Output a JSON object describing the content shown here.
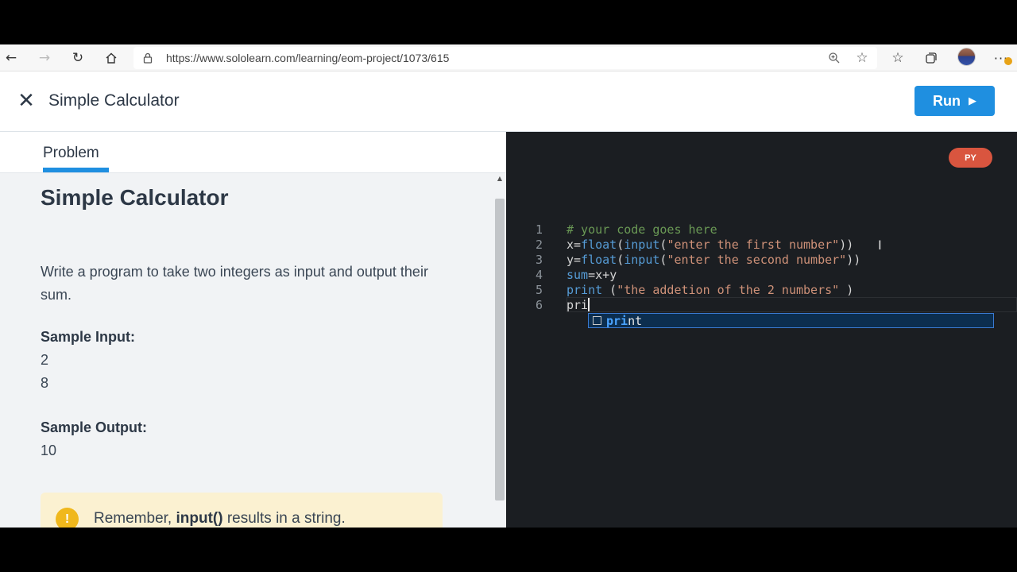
{
  "browser": {
    "url": "https://www.sololearn.com/learning/eom-project/1073/615",
    "icons": {
      "back": "back-arrow-icon",
      "forward": "forward-arrow-icon",
      "refresh": "refresh-icon",
      "home": "home-icon",
      "lock": "lock-icon",
      "zoom": "zoom-icon",
      "add_favorite": "add-favorite-icon",
      "favorites": "favorites-icon",
      "collections": "collections-icon",
      "menu": "more-icon"
    }
  },
  "header": {
    "title": "Simple Calculator",
    "run_label": "Run"
  },
  "left_panel": {
    "tab_label": "Problem",
    "heading": "Simple Calculator",
    "description": "Write a program to take two integers as input and output their sum.",
    "sample_input_label": "Sample Input:",
    "sample_input": [
      "2",
      "8"
    ],
    "sample_output_label": "Sample Output:",
    "sample_output": [
      "10"
    ],
    "hint": {
      "prefix": "Remember, ",
      "emphasis": "input()",
      "suffix": " results in a string."
    }
  },
  "editor": {
    "language_badge": "PY",
    "line_numbers": [
      "1",
      "2",
      "3",
      "4",
      "5",
      "6"
    ],
    "lines": [
      [
        {
          "t": "# your code goes here",
          "k": "comment"
        }
      ],
      [
        {
          "t": "x",
          "k": "var"
        },
        {
          "t": "=",
          "k": "op"
        },
        {
          "t": "float",
          "k": "builtin"
        },
        {
          "t": "(",
          "k": "op"
        },
        {
          "t": "input",
          "k": "builtin"
        },
        {
          "t": "(",
          "k": "op"
        },
        {
          "t": "\"enter the first number\"",
          "k": "string"
        },
        {
          "t": "))",
          "k": "op"
        }
      ],
      [
        {
          "t": "y",
          "k": "var"
        },
        {
          "t": "=",
          "k": "op"
        },
        {
          "t": "float",
          "k": "builtin"
        },
        {
          "t": "(",
          "k": "op"
        },
        {
          "t": "input",
          "k": "builtin"
        },
        {
          "t": "(",
          "k": "op"
        },
        {
          "t": "\"enter the second number\"",
          "k": "string"
        },
        {
          "t": "))",
          "k": "op"
        }
      ],
      [
        {
          "t": "sum",
          "k": "builtin"
        },
        {
          "t": "=",
          "k": "op"
        },
        {
          "t": "x",
          "k": "var"
        },
        {
          "t": "+",
          "k": "op"
        },
        {
          "t": "y",
          "k": "var"
        }
      ],
      [
        {
          "t": "print",
          "k": "builtin"
        },
        {
          "t": " (",
          "k": "op"
        },
        {
          "t": "\"the addetion of the 2 numbers\"",
          "k": "string"
        },
        {
          "t": " )",
          "k": "op"
        }
      ],
      [
        {
          "t": "pri",
          "k": "var"
        }
      ]
    ],
    "autocomplete": {
      "match": "pri",
      "rest": "nt"
    }
  },
  "colors": {
    "accent": "#1f8fe0",
    "editor_bg": "#1b1e22",
    "badge": "#d9553f",
    "hint_bg": "#fbf1d1"
  }
}
